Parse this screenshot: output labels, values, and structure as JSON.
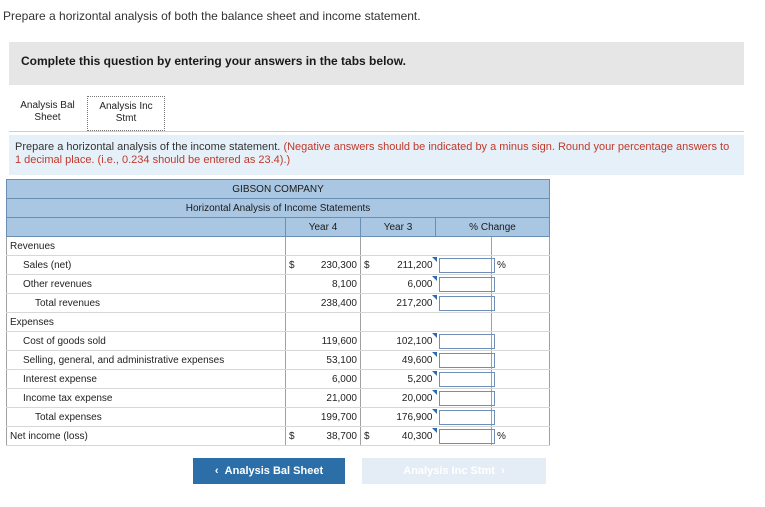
{
  "prompt": "Prepare a horizontal analysis of both the balance sheet and income statement.",
  "banner": "Complete this question by entering your answers in the tabs below.",
  "tabs": [
    {
      "line1": "Analysis Bal",
      "line2": "Sheet"
    },
    {
      "line1": "Analysis Inc",
      "line2": "Stmt"
    }
  ],
  "instruction": {
    "main": "Prepare a horizontal analysis of the income statement.",
    "note": "(Negative answers should be indicated by a minus sign. Round your percentage answers to 1 decimal place. (i.e., 0.234 should be entered as 23.4).)"
  },
  "table": {
    "company": "GIBSON COMPANY",
    "subtitle": "Horizontal Analysis of Income Statements",
    "col_year4": "Year 4",
    "col_year3": "Year 3",
    "col_change": "% Change",
    "currency": "$",
    "pct_sign": "%",
    "rows": {
      "revenues": {
        "label": "Revenues"
      },
      "sales": {
        "label": "Sales (net)",
        "y4": "230,300",
        "y3": "211,200"
      },
      "other_rev": {
        "label": "Other revenues",
        "y4": "8,100",
        "y3": "6,000"
      },
      "total_rev": {
        "label": "Total revenues",
        "y4": "238,400",
        "y3": "217,200"
      },
      "expenses": {
        "label": "Expenses"
      },
      "cogs": {
        "label": "Cost of goods sold",
        "y4": "119,600",
        "y3": "102,100"
      },
      "sga": {
        "label": "Selling, general, and administrative expenses",
        "y4": "53,100",
        "y3": "49,600"
      },
      "interest": {
        "label": "Interest expense",
        "y4": "6,000",
        "y3": "5,200"
      },
      "tax": {
        "label": "Income tax expense",
        "y4": "21,000",
        "y3": "20,000"
      },
      "total_exp": {
        "label": "Total expenses",
        "y4": "199,700",
        "y3": "176,900"
      },
      "net_income": {
        "label": "Net income (loss)",
        "y4": "38,700",
        "y3": "40,300"
      }
    }
  },
  "buttons": {
    "prev": "Analysis Bal Sheet",
    "next": "Analysis Inc Stmt"
  }
}
